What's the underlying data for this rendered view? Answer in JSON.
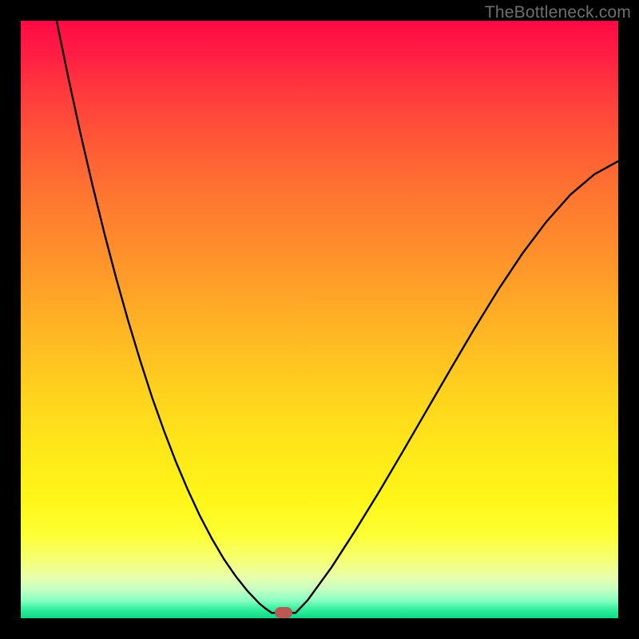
{
  "watermark": "TheBottleneck.com",
  "colors": {
    "curve_stroke": "#000000",
    "marker_fill": "#b85a53",
    "frame_bg": "#000000"
  },
  "chart_data": {
    "type": "line",
    "title": "",
    "xlabel": "",
    "ylabel": "",
    "xlim": [
      0,
      100
    ],
    "ylim": [
      0,
      100
    ],
    "left_branch": {
      "x": [
        6,
        8,
        10,
        12,
        14,
        16,
        18,
        20,
        22,
        24,
        26,
        28,
        30,
        32,
        34,
        36,
        38,
        40,
        41,
        42
      ],
      "y": [
        100,
        90.3,
        81.1,
        72.5,
        64.4,
        56.8,
        49.7,
        43.1,
        36.9,
        31.3,
        26.1,
        21.4,
        17.1,
        13.3,
        9.9,
        7.0,
        4.5,
        2.4,
        1.6,
        0.9
      ]
    },
    "flat": {
      "x": [
        42,
        46
      ],
      "y": [
        0.9,
        0.9
      ]
    },
    "right_branch": {
      "x": [
        46,
        48,
        52,
        56,
        60,
        64,
        68,
        72,
        76,
        80,
        84,
        88,
        92,
        96,
        100
      ],
      "y": [
        0.9,
        3.0,
        8.5,
        14.7,
        21.2,
        28.0,
        34.9,
        41.8,
        48.6,
        55.1,
        61.1,
        66.4,
        70.9,
        74.3,
        76.5
      ]
    },
    "marker": {
      "x": 44,
      "y": 0.9
    },
    "gradient_stops": [
      {
        "pos": 0,
        "color": "#ff0a46"
      },
      {
        "pos": 0.4,
        "color": "#ff932b"
      },
      {
        "pos": 0.7,
        "color": "#ffe41a"
      },
      {
        "pos": 0.93,
        "color": "#e9ffaa"
      },
      {
        "pos": 1.0,
        "color": "#10d884"
      }
    ]
  }
}
